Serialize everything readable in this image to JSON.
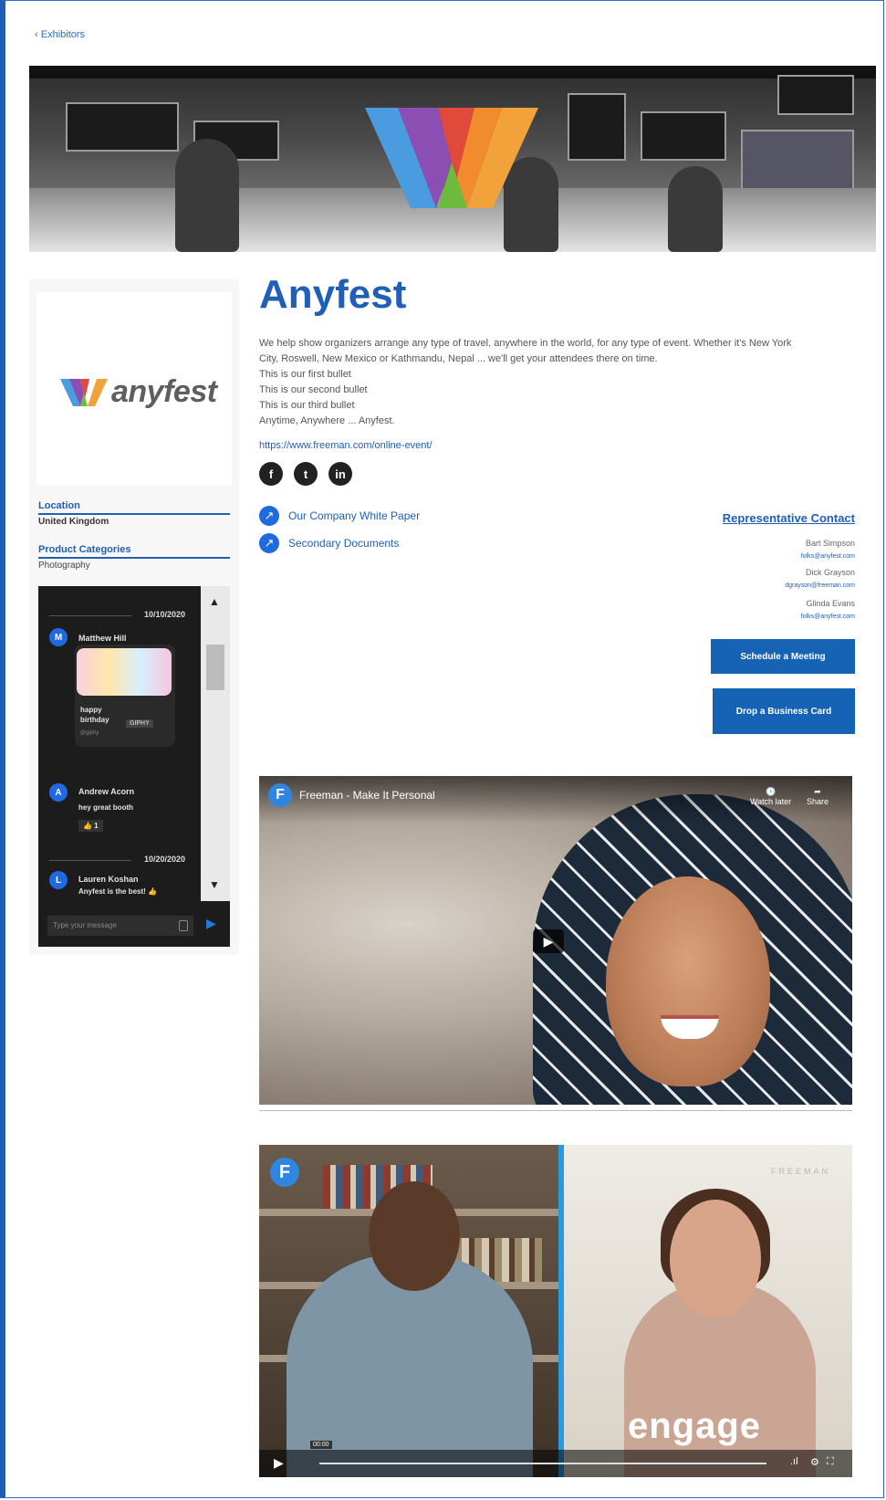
{
  "nav": {
    "back_label": "Exhibitors"
  },
  "sidebar": {
    "logo_word": "anyfest",
    "location_label": "Location",
    "location_value": "United Kingdom",
    "categories_label": "Product Categories",
    "categories_value": "Photography"
  },
  "chat": {
    "messages": [
      {
        "date": "10/10/2020",
        "initial": "M",
        "name": "Matthew Hill",
        "gif_caption": "happy birthday",
        "gif_tag": "GIPHY",
        "gif_sub": "@giphy"
      },
      {
        "initial": "A",
        "name": "Andrew Acorn",
        "text": "hey great booth",
        "reaction": "👍 1"
      },
      {
        "date": "10/20/2020",
        "initial": "L",
        "name": "Lauren Koshan",
        "text": "Anyfest is the best! 👍"
      }
    ],
    "input_placeholder": "Type your message"
  },
  "main": {
    "title": "Anyfest",
    "description_lines": [
      "We help show organizers arrange any type of travel, anywhere in the world, for any type of event. Whether it's New York",
      "City, Roswell, New Mexico or Kathmandu, Nepal ... we'll get your attendees there on time.",
      "This is our first bullet",
      "This is our second bullet",
      "This is our third bullet",
      "Anytime, Anywhere ... Anyfest."
    ],
    "website": "https://www.freeman.com/online-event/",
    "documents": [
      "Our Company White Paper",
      "Secondary Documents"
    ]
  },
  "representatives": {
    "title": "Representative Contact",
    "contacts": [
      {
        "name": "Bart Simpson",
        "email": "folks@anyfest.com"
      },
      {
        "name": "Dick Grayson",
        "email": "dgrayson@freeman.com"
      },
      {
        "name": "Glinda Evans",
        "email": "folks@anyfest.com"
      }
    ],
    "schedule_label": "Schedule a Meeting",
    "drop_card_label": "Drop a Business Card"
  },
  "video1": {
    "badge": "F",
    "title": "Freeman - Make It Personal",
    "watch_later": "Watch later",
    "share": "Share"
  },
  "video2": {
    "badge": "F",
    "overlay_word": "engage",
    "brand": "FREEMAN",
    "time": "00:00"
  },
  "colors": {
    "brand_blue": "#1f5fb8",
    "button_blue": "#1663b6"
  },
  "icons": [
    "back-chevron-icon",
    "facebook-icon",
    "twitter-icon",
    "linkedin-icon",
    "document-link-icon",
    "send-icon",
    "play-icon"
  ]
}
